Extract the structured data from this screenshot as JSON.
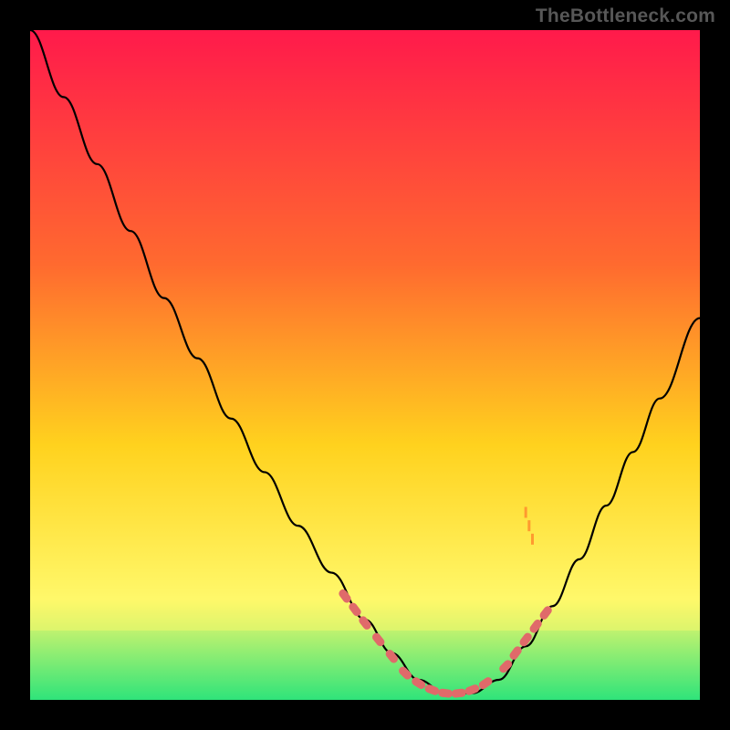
{
  "watermark": "TheBottleneck.com",
  "colors": {
    "frame": "#000000",
    "gradient_top": "#ff1a4b",
    "gradient_mid1": "#ff6a2f",
    "gradient_mid2": "#ffd21e",
    "gradient_mid3": "#fff86a",
    "gradient_bottom": "#2fe47a",
    "curve": "#000000",
    "marker": "#e06a6a",
    "orange_tick": "#ff9a2f"
  },
  "chart_data": {
    "type": "line",
    "title": "",
    "xlabel": "",
    "ylabel": "",
    "xlim": [
      0,
      100
    ],
    "ylim": [
      0,
      100
    ],
    "grid": false,
    "legend": false,
    "series": [
      {
        "name": "bottleneck-curve",
        "x": [
          0,
          5,
          10,
          15,
          20,
          25,
          30,
          35,
          40,
          45,
          50,
          54,
          58,
          62,
          66,
          70,
          74,
          78,
          82,
          86,
          90,
          94,
          100
        ],
        "y": [
          100,
          90,
          80,
          70,
          60,
          51,
          42,
          34,
          26,
          19,
          12,
          7,
          3,
          1,
          1,
          3,
          8,
          14,
          21,
          29,
          37,
          45,
          57
        ]
      }
    ],
    "markers": {
      "name": "highlight-dots",
      "points": [
        {
          "x": 47,
          "y": 15.5
        },
        {
          "x": 48.5,
          "y": 13.5
        },
        {
          "x": 50,
          "y": 11.5
        },
        {
          "x": 52,
          "y": 9
        },
        {
          "x": 54,
          "y": 6.5
        },
        {
          "x": 56,
          "y": 4
        },
        {
          "x": 58,
          "y": 2.5
        },
        {
          "x": 60,
          "y": 1.5
        },
        {
          "x": 62,
          "y": 1
        },
        {
          "x": 64,
          "y": 1
        },
        {
          "x": 66,
          "y": 1.5
        },
        {
          "x": 68,
          "y": 2.5
        },
        {
          "x": 71,
          "y": 5
        },
        {
          "x": 72.5,
          "y": 7
        },
        {
          "x": 74,
          "y": 9
        },
        {
          "x": 75.5,
          "y": 11
        },
        {
          "x": 77,
          "y": 13
        }
      ]
    },
    "orange_ticks": {
      "name": "orange-ticks",
      "points": [
        {
          "x": 74,
          "y": 28
        },
        {
          "x": 74.5,
          "y": 26
        },
        {
          "x": 75,
          "y": 24
        }
      ]
    }
  }
}
